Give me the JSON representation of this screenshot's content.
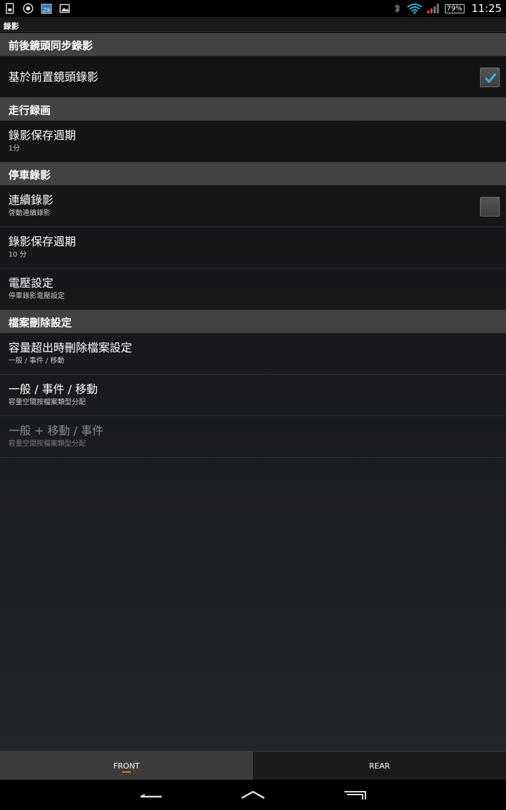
{
  "status_bar": {
    "battery": "79%",
    "time": "11:25",
    "calendar_day": "29"
  },
  "title_bar": {
    "title": "錄影"
  },
  "sections": [
    {
      "header": "前後鏡頭同步錄影",
      "items": [
        {
          "title": "基於前置鏡頭錄影",
          "summary": "",
          "checkbox": true,
          "checked": true,
          "disabled": false
        }
      ]
    },
    {
      "header": "走行録画",
      "items": [
        {
          "title": "錄影保存週期",
          "summary": "1分",
          "checkbox": false,
          "disabled": false
        }
      ]
    },
    {
      "header": "停車錄影",
      "items": [
        {
          "title": "連續錄影",
          "summary": "啓動連續錄影",
          "checkbox": true,
          "checked": false,
          "disabled": false
        },
        {
          "title": "錄影保存週期",
          "summary": "10 分",
          "checkbox": false,
          "disabled": false
        },
        {
          "title": "電壓設定",
          "summary": "停車錄影電壓設定",
          "checkbox": false,
          "disabled": false
        }
      ]
    },
    {
      "header": "檔案刪除設定",
      "items": [
        {
          "title": "容量超出時刪除檔案設定",
          "summary": "一般 / 事件 / 移動",
          "checkbox": false,
          "disabled": false
        },
        {
          "title": "一般 / 事件 / 移動",
          "summary": "容量空間按檔案類型分配",
          "checkbox": false,
          "disabled": false
        },
        {
          "title": "一般 + 移動 / 事件",
          "summary": "容量空間按檔案類型分配",
          "checkbox": false,
          "disabled": true
        }
      ]
    }
  ],
  "tabs": [
    {
      "label": "FRONT",
      "active": true
    },
    {
      "label": "REAR",
      "active": false
    }
  ],
  "colors": {
    "accent_check": "#33b5e5",
    "tab_indicator": "#e8772a",
    "section_header_bg": "#424242"
  }
}
